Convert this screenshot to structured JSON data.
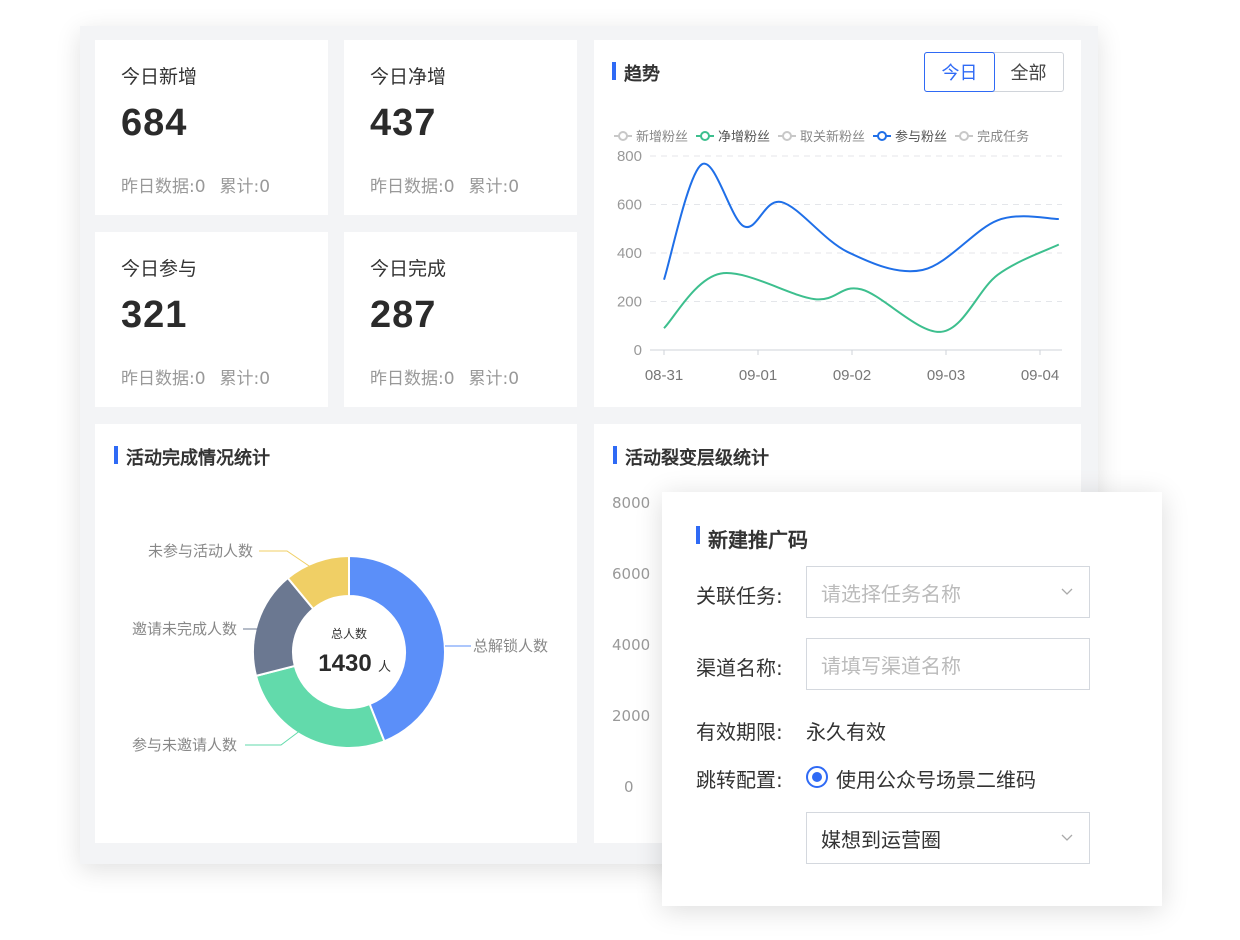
{
  "stats": [
    {
      "title": "今日新增",
      "value": "684",
      "yesterday": "昨日数据:0",
      "total": "累计:0"
    },
    {
      "title": "今日净增",
      "value": "437",
      "yesterday": "昨日数据:0",
      "total": "累计:0"
    },
    {
      "title": "今日参与",
      "value": "321",
      "yesterday": "昨日数据:0",
      "total": "累计:0"
    },
    {
      "title": "今日完成",
      "value": "287",
      "yesterday": "昨日数据:0",
      "total": "累计:0"
    }
  ],
  "trend": {
    "title": "趋势",
    "tabs": [
      "今日",
      "全部"
    ],
    "active_tab": "今日",
    "legend": [
      {
        "name": "新增粉丝",
        "color": "#c8c8c8"
      },
      {
        "name": "净增粉丝",
        "color": "#3dbf8e"
      },
      {
        "name": "取关新粉丝",
        "color": "#c8c8c8"
      },
      {
        "name": "参与粉丝",
        "color": "#1f6fe8"
      },
      {
        "name": "完成任务",
        "color": "#c8c8c8"
      }
    ]
  },
  "activity": {
    "title": "活动完成情况统计",
    "center_label": "总人数",
    "center_value": "1430",
    "center_unit": "人",
    "labels": {
      "unlocked": "总解锁人数",
      "not_joined": "未参与活动人数",
      "invite_incomplete": "邀请未完成人数",
      "joined_no_invite": "参与未邀请人数"
    }
  },
  "fission": {
    "title": "活动裂变层级统计",
    "y_ticks": [
      "8000",
      "6000",
      "4000",
      "2000",
      "0"
    ]
  },
  "modal": {
    "title": "新建推广码",
    "task_label": "关联任务:",
    "task_placeholder": "请选择任务名称",
    "channel_label": "渠道名称:",
    "channel_placeholder": "请填写渠道名称",
    "validity_label": "有效期限:",
    "validity_value": "永久有效",
    "jump_label": "跳转配置:",
    "jump_option": "使用公众号场景二维码",
    "select_value": "媒想到运营圈"
  },
  "chart_data": [
    {
      "type": "line",
      "x": [
        "08-31",
        "09-01",
        "09-02",
        "09-03",
        "09-04"
      ],
      "ylim": [
        0,
        800
      ],
      "y_ticks": [
        0,
        200,
        400,
        600,
        800
      ],
      "grid": true,
      "series": [
        {
          "name": "参与粉丝",
          "color": "#1f6fe8",
          "points": [
            [
              0,
              290
            ],
            [
              0.4,
              765
            ],
            [
              0.85,
              510
            ],
            [
              1.25,
              610
            ],
            [
              1.95,
              405
            ],
            [
              2.75,
              330
            ],
            [
              3.55,
              535
            ],
            [
              4.2,
              540
            ]
          ]
        },
        {
          "name": "净增粉丝",
          "color": "#3dbf8e",
          "points": [
            [
              0,
              90
            ],
            [
              0.6,
              315
            ],
            [
              1.6,
              210
            ],
            [
              2.1,
              250
            ],
            [
              2.95,
              75
            ],
            [
              3.55,
              310
            ],
            [
              4.2,
              435
            ]
          ]
        }
      ]
    },
    {
      "type": "pie",
      "donut": true,
      "total": 1430,
      "slices": [
        {
          "label": "总解锁人数",
          "value": 44,
          "color": "#5b8ff9"
        },
        {
          "label": "参与未邀请人数",
          "value": 27,
          "color": "#62daab"
        },
        {
          "label": "邀请未完成人数",
          "value": 18,
          "color": "#6b7891"
        },
        {
          "label": "未参与活动人数",
          "value": 11,
          "color": "#f0cf65"
        }
      ]
    }
  ]
}
